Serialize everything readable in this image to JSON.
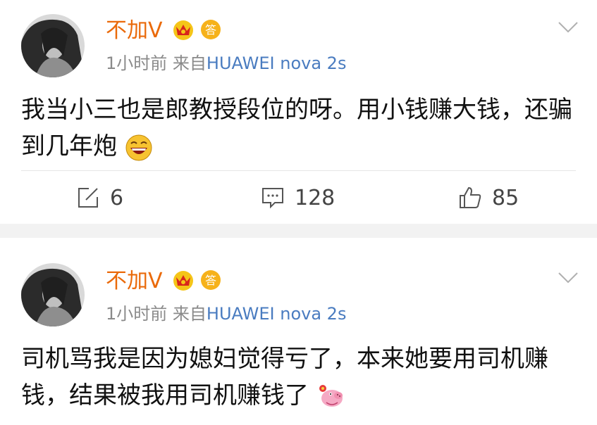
{
  "posts": [
    {
      "username": "不加V",
      "time": "1小时前",
      "source_prefix": "来自",
      "source": "HUAWEI nova 2s",
      "text_line1": "我当小三也是郎教授段位的呀。用小钱赚大钱，还骗",
      "text_line2": "到几年炮",
      "emoji": "grin-emoji",
      "reposts": "6",
      "comments": "128",
      "likes": "85"
    },
    {
      "username": "不加V",
      "time": "1小时前",
      "source_prefix": "来自",
      "source": "HUAWEI nova 2s",
      "text_line1": "司机骂我是因为媳妇觉得亏了，本来她要用司机赚",
      "text_line2": "钱，结果被我用司机赚钱了",
      "emoji": "peppa-pig-emoji"
    }
  ],
  "colors": {
    "username": "#ea6a0a",
    "source": "#4a7cc0",
    "meta": "#8a8a8a",
    "divider": "#f2f2f2"
  }
}
